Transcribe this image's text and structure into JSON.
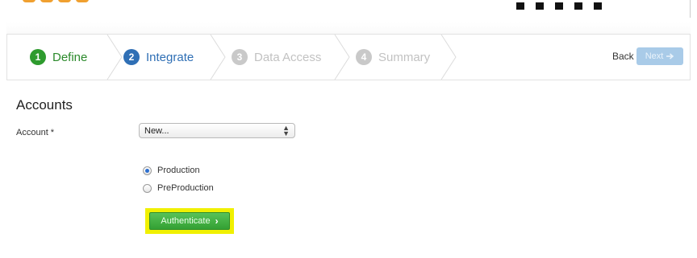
{
  "wizard": {
    "steps": [
      {
        "num": "1",
        "label": "Define",
        "state": "done"
      },
      {
        "num": "2",
        "label": "Integrate",
        "state": "active"
      },
      {
        "num": "3",
        "label": "Data Access",
        "state": "disabled"
      },
      {
        "num": "4",
        "label": "Summary",
        "state": "disabled"
      }
    ],
    "back_label": "Back",
    "next_label": "Next",
    "next_icon": "arrow-right-icon"
  },
  "accounts": {
    "title": "Accounts",
    "account_label": "Account *",
    "account_value": "New...",
    "environments": [
      {
        "label": "Production",
        "checked": true
      },
      {
        "label": "PreProduction",
        "checked": false
      }
    ],
    "authenticate_label": "Authenticate",
    "authenticate_icon": "chevron-right-icon"
  },
  "colors": {
    "done": "#2e9b2e",
    "active": "#2f6fb5",
    "disabled": "#c9c9c9",
    "highlight": "#f0f000",
    "authenticate_button": "#33a033"
  }
}
